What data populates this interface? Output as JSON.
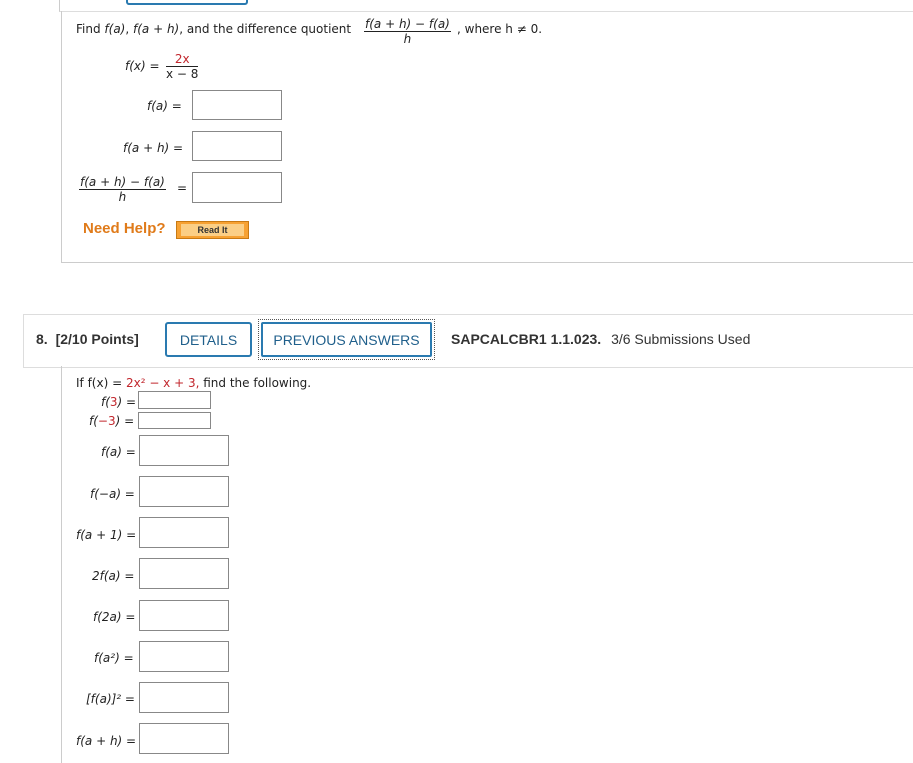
{
  "q7": {
    "prompt_pre": "Find ",
    "prompt_fa": "f(a)",
    "prompt_sep1": ", ",
    "prompt_fah": "f(a + h)",
    "prompt_mid": ", and the difference quotient",
    "dq_num": "f(a + h) − f(a)",
    "dq_den": "h",
    "prompt_post": ", where h ≠ 0.",
    "fx_label": "f(x) =",
    "fx_num": "2x",
    "fx_den": "x − 8",
    "rows": [
      {
        "label": "f(a) ="
      },
      {
        "label": "f(a + h) ="
      }
    ],
    "dq_eq": "=",
    "need_help": "Need Help?",
    "read_it": "Read It"
  },
  "q8": {
    "number": "8.",
    "points": "[2/10 Points]",
    "details_btn": "DETAILS",
    "prev_answers_btn": "PREVIOUS ANSWERS",
    "course_code": "SAPCALCBR1 1.1.023.",
    "submissions": "3/6 Submissions Used",
    "prompt_pre": "If f(x) = ",
    "prompt_expr": "2x² − x + 3,",
    "prompt_post": " find the following.",
    "small_rows": [
      {
        "pre": "f(",
        "val": "3",
        "post": ") ="
      },
      {
        "pre": "f(",
        "val": "−3",
        "post": ") ="
      }
    ],
    "rows": [
      {
        "label": "f(a) ="
      },
      {
        "label": "f(−a) ="
      },
      {
        "label": "f(a + 1) ="
      },
      {
        "label": "2f(a) ="
      },
      {
        "label": "f(2a) ="
      },
      {
        "label": "f(a²) ="
      },
      {
        "label": "[f(a)]² ="
      },
      {
        "label": "f(a + h) ="
      }
    ]
  }
}
